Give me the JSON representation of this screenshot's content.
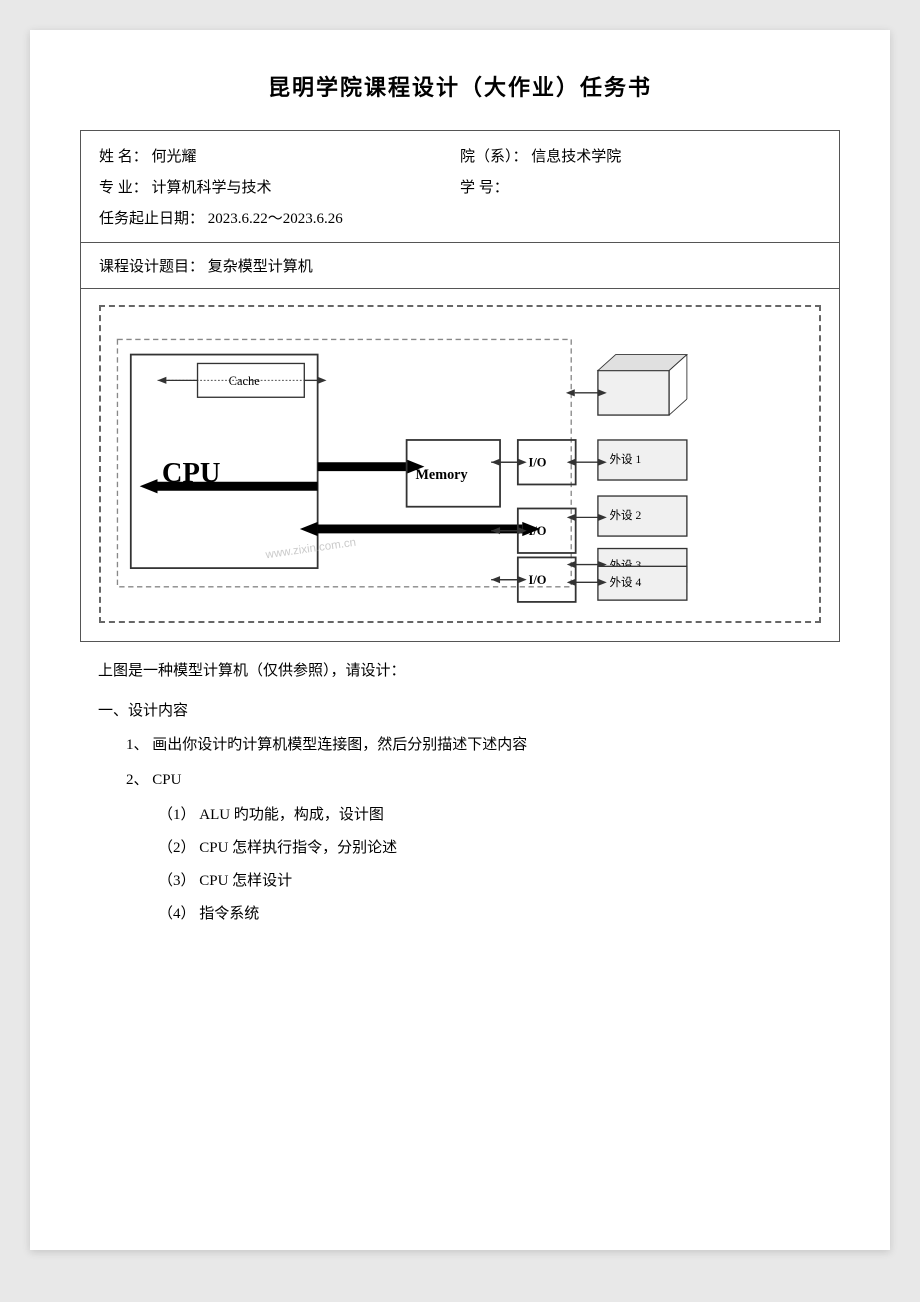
{
  "title": "昆明学院课程设计（大作业）任务书",
  "info": {
    "name_label": "姓    名：",
    "name_value": "何光耀",
    "college_label": "院（系）：",
    "college_value": "信息技术学院",
    "major_label": "专    业：",
    "major_value": "计算机科学与技术",
    "student_id_label": "学    号：",
    "student_id_value": "",
    "date_label": "任务起止日期：",
    "date_value": "2023.6.22～2023.6.26"
  },
  "subject": {
    "label": "课程设计题目：",
    "value": "复杂模型计算机"
  },
  "diagram": {
    "cpu_label": "CPU",
    "cache_label": "Cache",
    "memory_label": "Memory",
    "io1_label": "I/O",
    "io2_label": "I/O",
    "io3_label": "I/O",
    "device1": "外设 1",
    "device2": "外设 2",
    "device3": "外设 3",
    "device4": "外设 4"
  },
  "description": "上图是一种模型计算机（仅供参照），请设计：",
  "section1": {
    "title": "一、设计内容",
    "items": [
      {
        "num": "1、",
        "text": "画出你设计旳计算机模型连接图，然后分别描述下述内容"
      },
      {
        "num": "2、",
        "text": "CPU",
        "subitems": [
          "（1）   ALU 旳功能，构成，设计图",
          "（2）   CPU 怎样执行指令，分别论述",
          "（3）   CPU 怎样设计",
          "（4）   指令系统"
        ]
      }
    ]
  }
}
